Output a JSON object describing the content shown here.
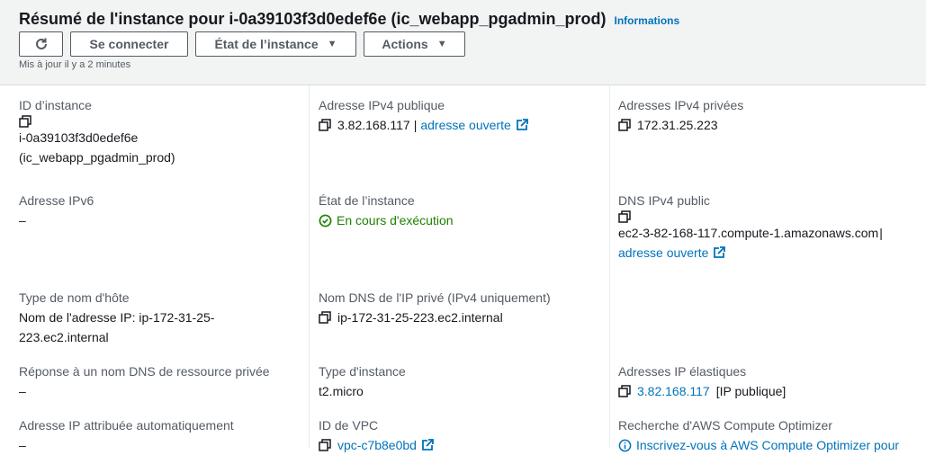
{
  "header": {
    "title": "Résumé de l'instance pour i-0a39103f3d0edef6e (ic_webapp_pgadmin_prod)",
    "info_link": "Informations",
    "buttons": {
      "connect": "Se connecter",
      "instance_state": "État de l’instance",
      "actions": "Actions"
    },
    "updated": "Mis à jour il y a 2 minutes"
  },
  "fields": {
    "instance_id": {
      "label": "ID d’instance",
      "value": "i-0a39103f3d0edef6e",
      "value2": "(ic_webapp_pgadmin_prod)"
    },
    "public_ipv4": {
      "label": "Adresse IPv4 publique",
      "value": "3.82.168.117",
      "sep": "|",
      "link": "adresse ouverte"
    },
    "private_ipv4": {
      "label": "Adresses IPv4 privées",
      "value": "172.31.25.223"
    },
    "ipv6": {
      "label": "Adresse IPv6",
      "value": "–"
    },
    "instance_state": {
      "label": "État de l’instance",
      "value": "En cours d'exécution"
    },
    "public_dns": {
      "label": "DNS IPv4 public",
      "value": "ec2-3-82-168-117.compute-1.amazonaws.com",
      "sep": "|",
      "link": "adresse ouverte"
    },
    "hostname_type": {
      "label": "Type de nom d'hôte",
      "value": "Nom de l'adresse IP: ip-172-31-25-",
      "value2": "223.ec2.internal"
    },
    "private_dns": {
      "label": "Nom DNS de l'IP privé (IPv4 uniquement)",
      "value": "ip-172-31-25-223.ec2.internal"
    },
    "resource_dns": {
      "label": "Réponse à un nom DNS de ressource privée",
      "value": "–"
    },
    "instance_type": {
      "label": "Type d'instance",
      "value": "t2.micro"
    },
    "elastic_ip": {
      "label": "Adresses IP élastiques",
      "value": "3.82.168.117",
      "suffix": "[IP publique]"
    },
    "auto_ip": {
      "label": "Adresse IP attribuée automatiquement",
      "value": "–"
    },
    "vpc_id": {
      "label": "ID de VPC",
      "value": "vpc-c7b8e0bd"
    },
    "compute_optimizer": {
      "label": "Recherche d'AWS Compute Optimizer",
      "value": "Inscrivez-vous à AWS Compute Optimizer pour"
    }
  },
  "colors": {
    "link": "#0073bb",
    "success": "#1d8102",
    "label": "#545b64",
    "header_bg": "#f2f3f3"
  }
}
